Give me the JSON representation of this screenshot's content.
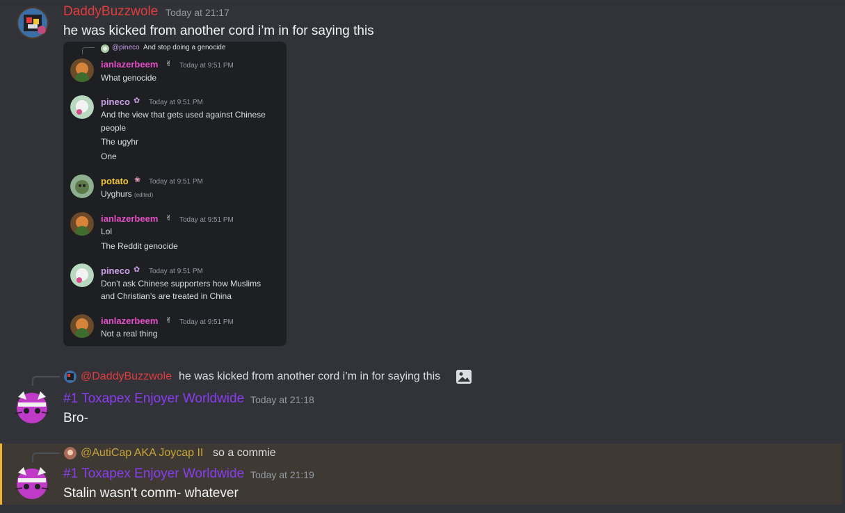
{
  "colors": {
    "background": "#313338",
    "highlight_bg": "#3e3a33",
    "highlight_bar": "#f0b232",
    "user_red": "#e23c3c",
    "user_purple": "#8a3cf0",
    "user_gold": "#c9a43c",
    "embed_pink": "#e44fc7",
    "embed_lilac": "#c9a0e8",
    "embed_yellow": "#f0c53c"
  },
  "messages": [
    {
      "username": "DaddyBuzzwole",
      "timestamp": "Today at 21:17",
      "text": "he was kicked from another cord i’m in for saying this",
      "avatar_icon": "buzzwole-avatar-icon"
    },
    {
      "reply": {
        "name": "@DaddyBuzzwole",
        "text": "he was kicked from another cord i’m in for saying this"
      },
      "username": "#1 Toxapex Enjoyer Worldwide",
      "timestamp": "Today at 21:18",
      "text": "Bro-",
      "avatar_icon": "cat-avatar-icon"
    },
    {
      "reply": {
        "name": "@AutiCap AKA Joycap II",
        "text": "so a commie"
      },
      "username": "#1 Toxapex Enjoyer Worldwide",
      "timestamp": "Today at 21:19",
      "text": "Stalin wasn't comm- whatever",
      "avatar_icon": "cat-avatar-icon"
    }
  ],
  "embed": {
    "reply": {
      "name": "@pineco",
      "text": "And stop doing a genocide"
    },
    "groups": [
      {
        "name": "ianlazerbeem",
        "time": "Today at 9:51 PM",
        "lines": [
          "What genocide"
        ]
      },
      {
        "name": "pineco",
        "time": "Today at 9:51 PM",
        "lines": [
          "And the view that gets used against Chinese",
          "people",
          "The ugyhr",
          "One"
        ]
      },
      {
        "name": "potato",
        "time": "Today at 9:51 PM",
        "lines": [
          "Uyghurs"
        ],
        "edited": "(edited)"
      },
      {
        "name": "ianlazerbeem",
        "time": "Today at 9:51 PM",
        "lines": [
          "Lol",
          "The Reddit genocide"
        ]
      },
      {
        "name": "pineco",
        "time": "Today at 9:51 PM",
        "lines": [
          "Don’t ask Chinese supporters how Muslims",
          "and Christian’s are treated in China"
        ]
      },
      {
        "name": "ianlazerbeem",
        "time": "Today at 9:51 PM",
        "lines": [
          "Not a real thing"
        ]
      }
    ]
  }
}
